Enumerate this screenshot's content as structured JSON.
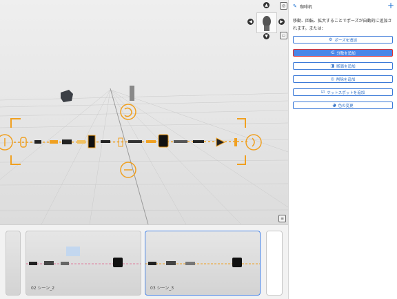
{
  "panel": {
    "title": "咖啡机",
    "description": "移動、回転、拡大することでポーズが自動的に追加されます。または：",
    "actions": [
      {
        "label": "ポーズを追加",
        "icon": "settings-icon"
      },
      {
        "label": "分散を追加",
        "icon": "share-icon"
      },
      {
        "label": "断面を追加",
        "icon": "section-icon"
      },
      {
        "label": "削除を追加",
        "icon": "delete-icon"
      },
      {
        "label": "ホットスポットを追加",
        "icon": "hotspot-icon"
      },
      {
        "label": "色の変更",
        "icon": "palette-icon"
      }
    ]
  },
  "timeline": {
    "scenes": [
      {
        "label": "02 シーン_2"
      },
      {
        "label": "03 シーン_3"
      }
    ]
  },
  "colors": {
    "accent": "#4a86e8",
    "selection": "#f0a020",
    "active_border": "#dd3333"
  }
}
